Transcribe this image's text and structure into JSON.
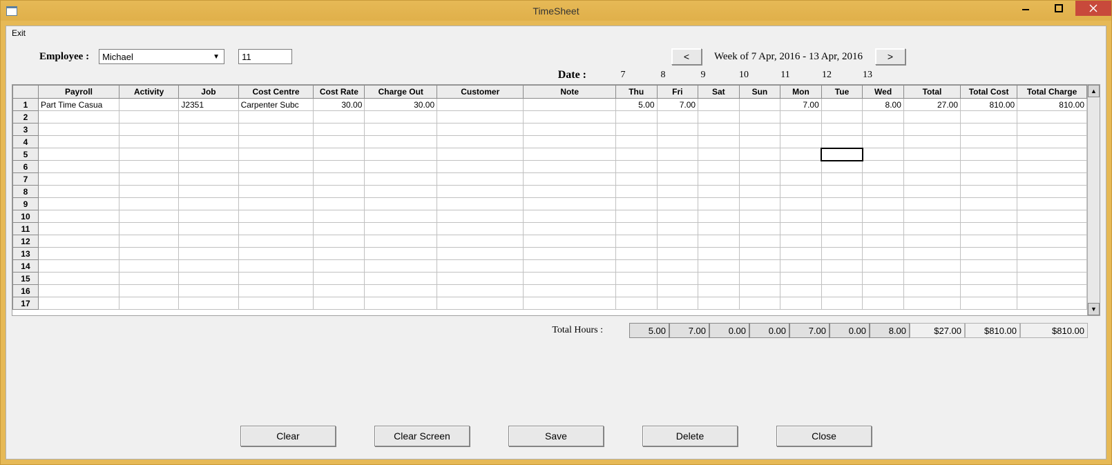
{
  "window": {
    "title": "TimeSheet"
  },
  "menu": {
    "exit": "Exit"
  },
  "employee": {
    "label": "Employee :",
    "name": "Michael",
    "code": "11"
  },
  "week": {
    "prev": "<",
    "next": ">",
    "label": "Week of 7 Apr, 2016 - 13 Apr, 2016",
    "date_label": "Date :",
    "dates": [
      "7",
      "8",
      "9",
      "10",
      "11",
      "12",
      "13"
    ]
  },
  "grid": {
    "headers": [
      "",
      "Payroll",
      "Activity",
      "Job",
      "Cost Centre",
      "Cost Rate",
      "Charge Out",
      "Customer",
      "Note",
      "Thu",
      "Fri",
      "Sat",
      "Sun",
      "Mon",
      "Tue",
      "Wed",
      "Total",
      "Total Cost",
      "Total Charge"
    ],
    "row_count": 17,
    "rows": [
      {
        "payroll": "Part Time Casua",
        "activity": "",
        "job": "J2351",
        "cost_centre": "Carpenter Subc",
        "cost_rate": "30.00",
        "charge_out": "30.00",
        "customer": "",
        "note": "",
        "thu": "5.00",
        "fri": "7.00",
        "sat": "",
        "sun": "",
        "mon": "7.00",
        "tue": "",
        "wed": "8.00",
        "total": "27.00",
        "total_cost": "810.00",
        "total_charge": "810.00"
      }
    ],
    "selected": {
      "row": 5,
      "col": "tue"
    }
  },
  "totals": {
    "label": "Total Hours :",
    "thu": "5.00",
    "fri": "7.00",
    "sat": "0.00",
    "sun": "0.00",
    "mon": "7.00",
    "tue": "0.00",
    "wed": "8.00",
    "total": "$27.00",
    "total_cost": "$810.00",
    "total_charge": "$810.00"
  },
  "buttons": {
    "clear": "Clear",
    "clear_screen": "Clear Screen",
    "save": "Save",
    "delete": "Delete",
    "close": "Close"
  }
}
